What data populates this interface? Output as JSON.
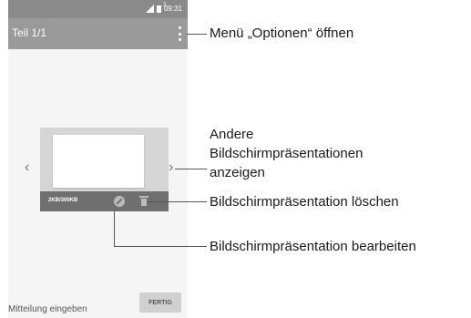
{
  "status_bar": {
    "time": "09:31",
    "sim_indicator": "1",
    "icons": [
      "signal-icon",
      "battery-icon"
    ]
  },
  "toolbar": {
    "title": "Teil 1/1",
    "menu_icon": "more-vert-icon"
  },
  "slide_card": {
    "size_text": "2KB/300KB",
    "edit_icon": "edit-icon",
    "delete_icon": "delete-icon"
  },
  "nav": {
    "prev": "‹",
    "next": "›"
  },
  "composer": {
    "placeholder": "Mitteilung eingeben",
    "send_label": "FERTIG"
  },
  "callouts": {
    "menu": "Menü „Optionen“ öffnen",
    "other_line1": "Andere",
    "other_line2": "Bildschirmpräsentationen",
    "other_line3": "anzeigen",
    "delete": "Bildschirmpräsentation löschen",
    "edit": "Bildschirmpräsentation bearbeiten"
  },
  "colors": {
    "toolbar": "#9a9a9a",
    "status_bar": "#8a8a8a",
    "card": "#d5d5d5",
    "card_bar": "#6f6f6f"
  }
}
